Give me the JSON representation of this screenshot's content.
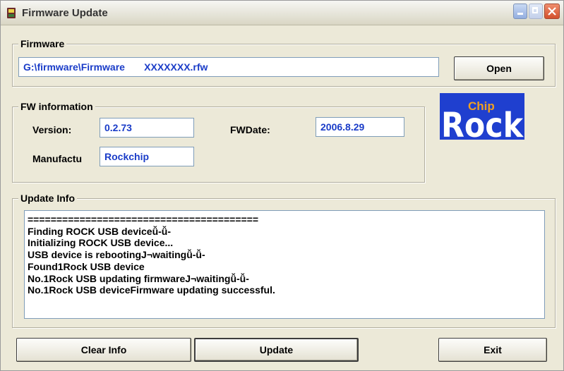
{
  "window": {
    "title": "Firmware Update",
    "icon": "app-icon"
  },
  "firmware": {
    "group_title": "Firmware",
    "path": "G:\\firmware\\Firmware       XXXXXXX.rfw",
    "open_label": "Open"
  },
  "fw_info": {
    "group_title": "FW information",
    "version_label": "Version:",
    "version_value": "0.2.73",
    "fwdate_label": "FWDate:",
    "fwdate_value": "2006.8.29",
    "manufacturer_label": "Manufactu",
    "manufacturer_value": "Rockchip"
  },
  "logo": {
    "small_text": "Chip",
    "big_text": "Rock"
  },
  "update_info": {
    "group_title": "Update Info",
    "lines": [
      "========================================",
      "Finding ROCK USB deviceǚ-ǚ-",
      "Initializing ROCK USB device...",
      "USB device is rebootingJ¬waitingǚ-ǚ-",
      "Found1Rock USB device",
      "No.1Rock USB updating firmwareJ¬waitingǚ-ǚ-",
      "No.1Rock USB deviceFirmware updating successful."
    ]
  },
  "buttons": {
    "clear_label": "Clear Info",
    "update_label": "Update",
    "exit_label": "Exit"
  },
  "colors": {
    "face": "#ece9d8",
    "field_text": "#1a3cc8",
    "logo_bg": "#1f3fcf",
    "logo_text": "#ffffff",
    "logo_chip": "#f0a020"
  }
}
